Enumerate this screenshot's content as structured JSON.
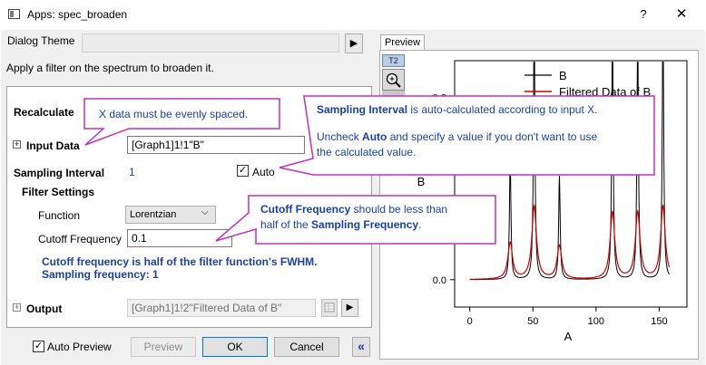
{
  "window": {
    "title": "Apps: spec_broaden",
    "help": "?",
    "close": "✕"
  },
  "theme": {
    "label": "Dialog Theme",
    "value": "",
    "arrow": "▶"
  },
  "description": "Apply a filter on the spectrum to broaden it.",
  "recalculate": {
    "label": "Recalculate"
  },
  "input_data": {
    "expander": "+",
    "label": "Input Data",
    "value": "[Graph1]1!1\"B\""
  },
  "sampling_interval": {
    "label": "Sampling Interval",
    "value": "1",
    "auto_checked": "✓",
    "auto_label": "Auto"
  },
  "filter_settings": {
    "label": "Filter Settings",
    "function_label": "Function",
    "function_value": "Lorentzian",
    "function_arrow": "⌵",
    "cutoff_label": "Cutoff Frequency",
    "cutoff_value": "0.1",
    "note1": "Cutoff frequency is half of the filter function's FWHM.",
    "note2": "Sampling frequency: 1"
  },
  "output": {
    "expander": "+",
    "label": "Output",
    "value": "[Graph1]1!2\"Filtered Data of B\"",
    "menu_arrow": "▶"
  },
  "footer": {
    "auto_preview_checked": "✓",
    "auto_preview_label": "Auto Preview",
    "preview": "Preview",
    "ok": "OK",
    "cancel": "Cancel",
    "collapse": "«"
  },
  "preview_tab": {
    "label": "Preview",
    "t2": "T2"
  },
  "callouts": {
    "x_spacing": "X data must be evenly spaced.",
    "sampling": {
      "line1_bold": "Sampling Interval",
      "line1_rest": " is auto-calculated according to input X.",
      "line2_pre": "Uncheck ",
      "line2_bold": "Auto",
      "line2_rest": " and specify a value if you don't want to use",
      "line3": "the calculated value."
    },
    "cutoff": {
      "line1_bold": "Cutoff Frequency",
      "line1_rest": " should be less than",
      "line2_pre": "half of the ",
      "line2_bold": "Sampling Frequency",
      "line2_rest": "."
    }
  },
  "chart_data": {
    "type": "line",
    "xlabel": "A",
    "ylabel": "B",
    "xlim": [
      -12,
      172
    ],
    "ylim": [
      -0.045,
      0.36
    ],
    "xticks": [
      "0",
      "50",
      "100",
      "150"
    ],
    "yticks": [
      "0.0",
      "0.3"
    ],
    "legend": {
      "position": "top-right",
      "entries": [
        "B",
        "Filtered Data of B"
      ]
    },
    "series": [
      {
        "name": "B",
        "color": "#000000",
        "peaks": [
          [
            32,
            0.2
          ],
          [
            51,
            0.44
          ],
          [
            71,
            0.17
          ],
          [
            113,
            0.42
          ],
          [
            133,
            0.41
          ],
          [
            153,
            0.43
          ]
        ]
      },
      {
        "name": "Filtered Data of B",
        "color": "#cc0000",
        "peaks": [
          [
            32,
            0.06
          ],
          [
            51,
            0.12
          ],
          [
            71,
            0.055
          ],
          [
            113,
            0.11
          ],
          [
            133,
            0.11
          ],
          [
            153,
            0.12
          ]
        ]
      }
    ]
  },
  "colors": {
    "note": "#1a3fa8",
    "callout_border": "#c030c0",
    "chart_red": "#cc0000"
  }
}
